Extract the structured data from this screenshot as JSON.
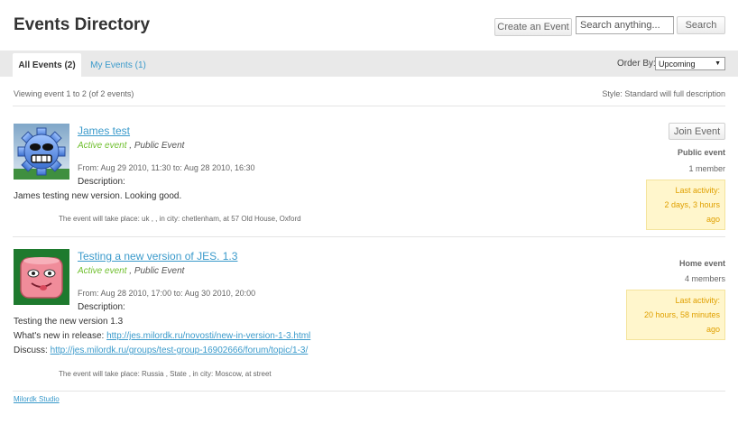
{
  "header": {
    "title": "Events Directory",
    "create_label": "Create an Event",
    "search_placeholder": "Search anything...",
    "search_label": "Search"
  },
  "tabs": [
    {
      "label": "All Events (2)",
      "active": true
    },
    {
      "label": "My Events (1)",
      "active": false
    }
  ],
  "order": {
    "label": "Order By:",
    "value": "Upcoming"
  },
  "summary": {
    "viewing": "Viewing event 1 to 2 (of 2 events)",
    "style": "Style: Standard will full description"
  },
  "events": [
    {
      "title": "James test",
      "status": "Active event",
      "privacy": ", Public Event",
      "dates": "From: Aug 29 2010, 11:30 to: Aug 28 2010, 16:30",
      "description_label": "Description:",
      "description": "James testing new version. Looking good.",
      "place": "The event will take place: uk , , in city: chetlenham, at 57 Old House, Oxford",
      "join_label": "Join Event",
      "type": "Public event",
      "members": "1 member",
      "activity_label": "Last activity:",
      "activity_value": "2 days, 3 hours ago",
      "avatar_icon": "gear-face-icon"
    },
    {
      "title": "Testing a new version of JES. 1.3",
      "status": "Active event",
      "privacy": ", Public Event",
      "dates": "From: Aug 28 2010, 17:00 to: Aug 30 2010, 20:00",
      "description_label": "Description:",
      "description": "Testing the new version 1.3",
      "whats_new_label": "What's new in release: ",
      "whats_new_link": "http://jes.milordk.ru/novosti/new-in-version-1-3.html",
      "discuss_label": "Discuss: ",
      "discuss_link": "http://jes.milordk.ru/groups/test-group-16902666/forum/topic/1-3/",
      "place": "The event will take place: Russia , State , in city: Moscow, at street",
      "type": "Home event",
      "members": "4 members",
      "activity_label": "Last activity:",
      "activity_value": "20 hours, 58 minutes ago",
      "avatar_icon": "pink-face-icon"
    }
  ],
  "footer": {
    "link": "Milordk Studio"
  },
  "colors": {
    "link": "#3a9acb",
    "active_status": "#6fbf2e",
    "activity_bg": "#fff6cc",
    "activity_text": "#e0a000"
  }
}
